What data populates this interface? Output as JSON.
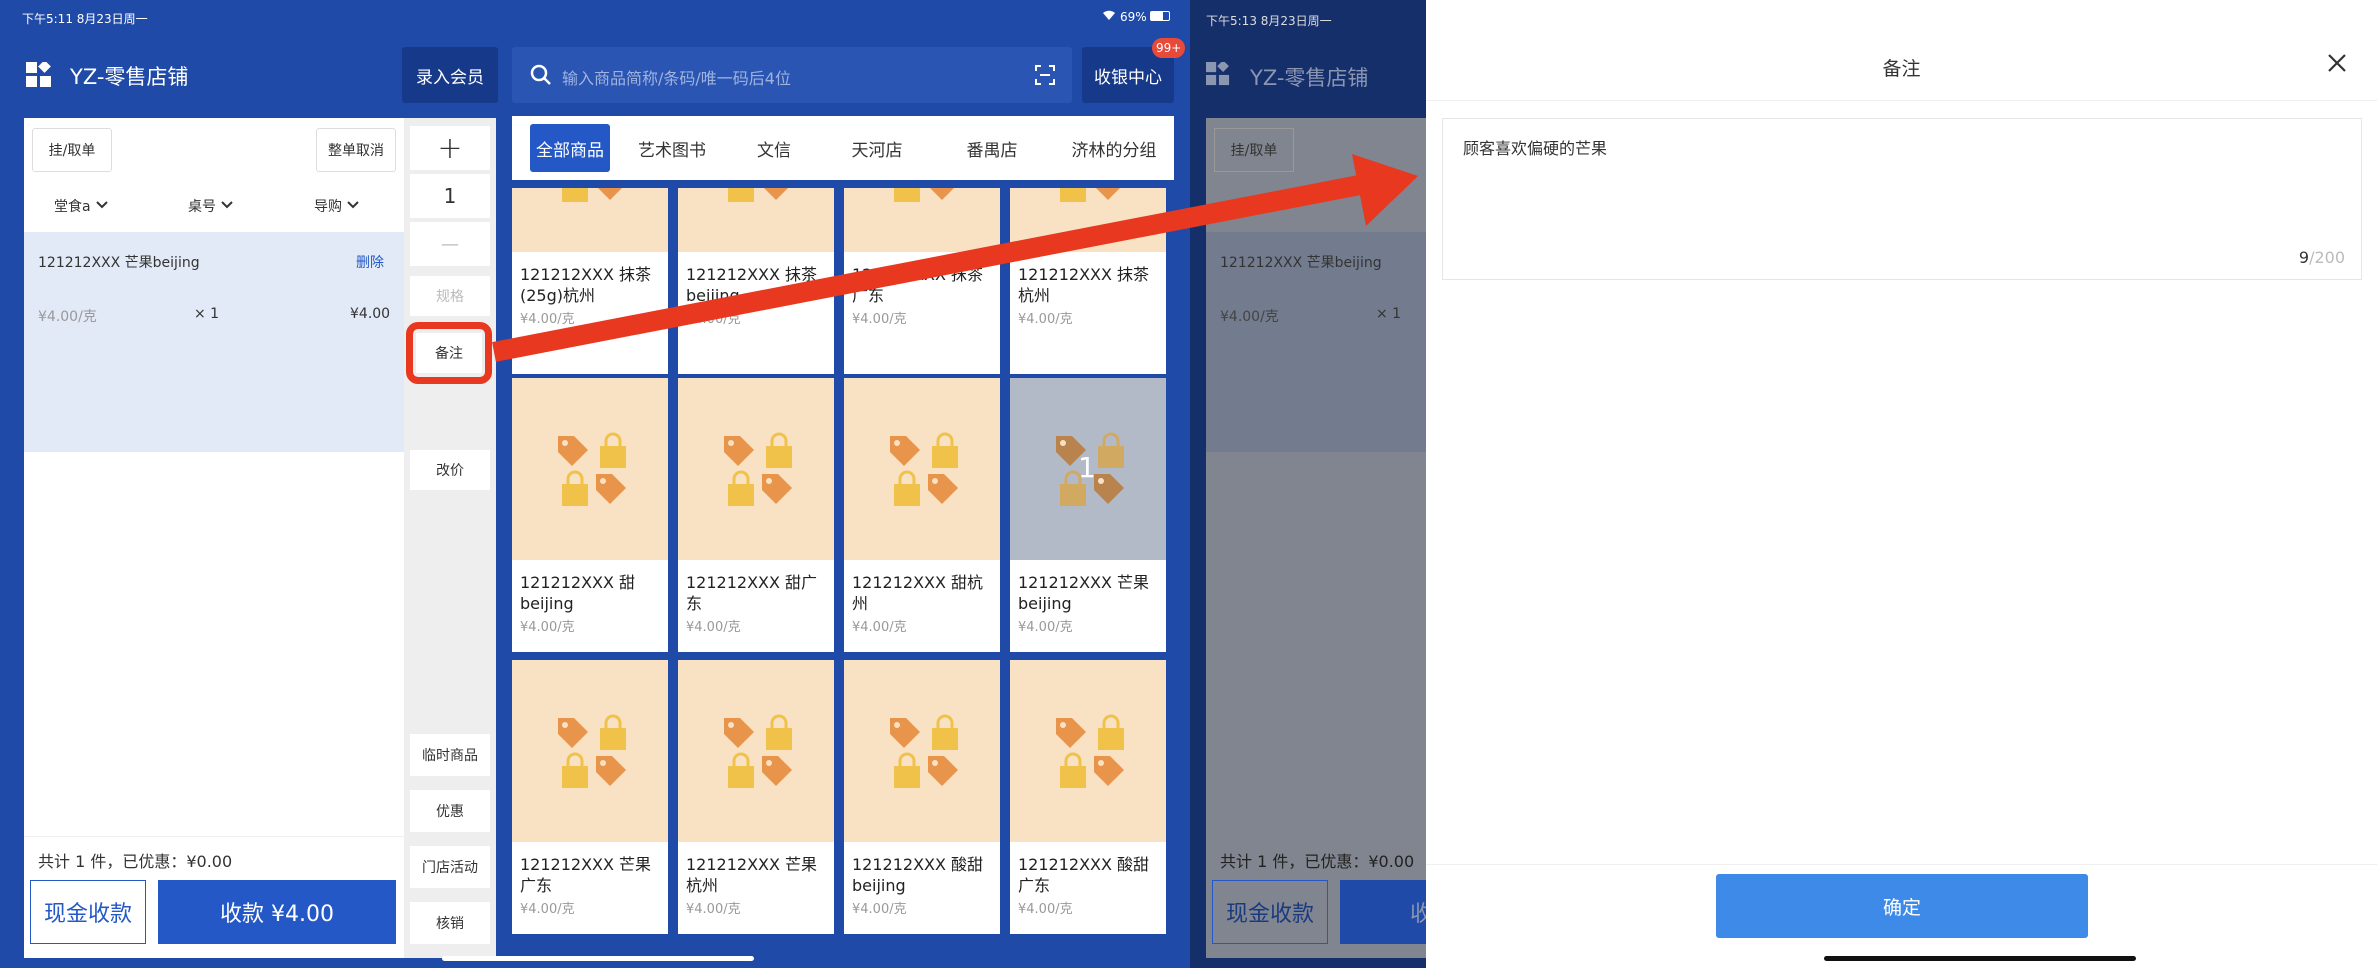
{
  "left": {
    "status": {
      "time": "下午5:11  8月23日周一",
      "battery": "69%"
    },
    "header": {
      "title": "YZ-零售店铺",
      "member_button": "录入会员",
      "search_placeholder": "输入商品简称/条码/唯一码后4位",
      "cashier_center": "收银中心",
      "cashier_badge": "99+"
    },
    "cart": {
      "hang_button": "挂/取单",
      "cancel_all_button": "整单取消",
      "filters": [
        "堂食a",
        "桌号",
        "导购"
      ],
      "item": {
        "name": "121212XXX 芒果beijing",
        "delete": "删除",
        "unit_price": "¥4.00/克",
        "qty": "× 1",
        "total": "¥4.00"
      },
      "summary": "共计 1 件，已优惠：¥0.00",
      "cash_button": "现金收款",
      "pay_button": "收款 ¥4.00"
    },
    "stepper": {
      "plus": "+",
      "value": "1",
      "minus": "—"
    },
    "actions": {
      "spec": "规格",
      "remark": "备注",
      "change_price": "改价",
      "temp_item": "临时商品",
      "discount": "优惠",
      "store_activity": "门店活动",
      "verify": "核销"
    },
    "tabs": [
      "全部商品",
      "艺术图书",
      "文信",
      "天河店",
      "番禺店",
      "济林的分组"
    ],
    "products": [
      {
        "name": "121212XXX 抹茶(25g)杭州",
        "price": "¥4.00/克"
      },
      {
        "name": "121212XXX 抹茶beijing",
        "price": "¥4.00/克"
      },
      {
        "name": "121212XXX 抹茶广东",
        "price": "¥4.00/克"
      },
      {
        "name": "121212XXX 抹茶杭州",
        "price": "¥4.00/克"
      },
      {
        "name": "121212XXX 甜beijing",
        "price": "¥4.00/克"
      },
      {
        "name": "121212XXX 甜广东",
        "price": "¥4.00/克"
      },
      {
        "name": "121212XXX 甜杭州",
        "price": "¥4.00/克"
      },
      {
        "name": "121212XXX 芒果beijing",
        "price": "¥4.00/克",
        "selected_count": "1"
      },
      {
        "name": "121212XXX 芒果广东",
        "price": "¥4.00/克"
      },
      {
        "name": "121212XXX 芒果杭州",
        "price": "¥4.00/克"
      },
      {
        "name": "121212XXX 酸甜beijing",
        "price": "¥4.00/克"
      },
      {
        "name": "121212XXX 酸甜广东",
        "price": "¥4.00/克"
      }
    ]
  },
  "right": {
    "status": {
      "time": "下午5:13  8月23日周一"
    },
    "bg": {
      "title": "YZ-零售店铺",
      "hang_button": "挂/取单",
      "item": "121212XXX 芒果beijing",
      "price": "¥4.00/克",
      "qty": "× 1",
      "summary": "共计 1 件，已优惠：¥0.00",
      "cash_button": "现金收款",
      "pay_fragment": "收"
    },
    "modal": {
      "title": "备注",
      "text": "顾客喜欢偏硬的芒果",
      "count": "9",
      "max": "/200",
      "confirm": "确定"
    }
  },
  "colors": {
    "brand_blue": "#1f4aa8",
    "accent_blue": "#2458c6",
    "confirm_blue": "#3d8ae8",
    "highlight_red": "#e8381f",
    "card_bg": "#f9e2c4"
  }
}
